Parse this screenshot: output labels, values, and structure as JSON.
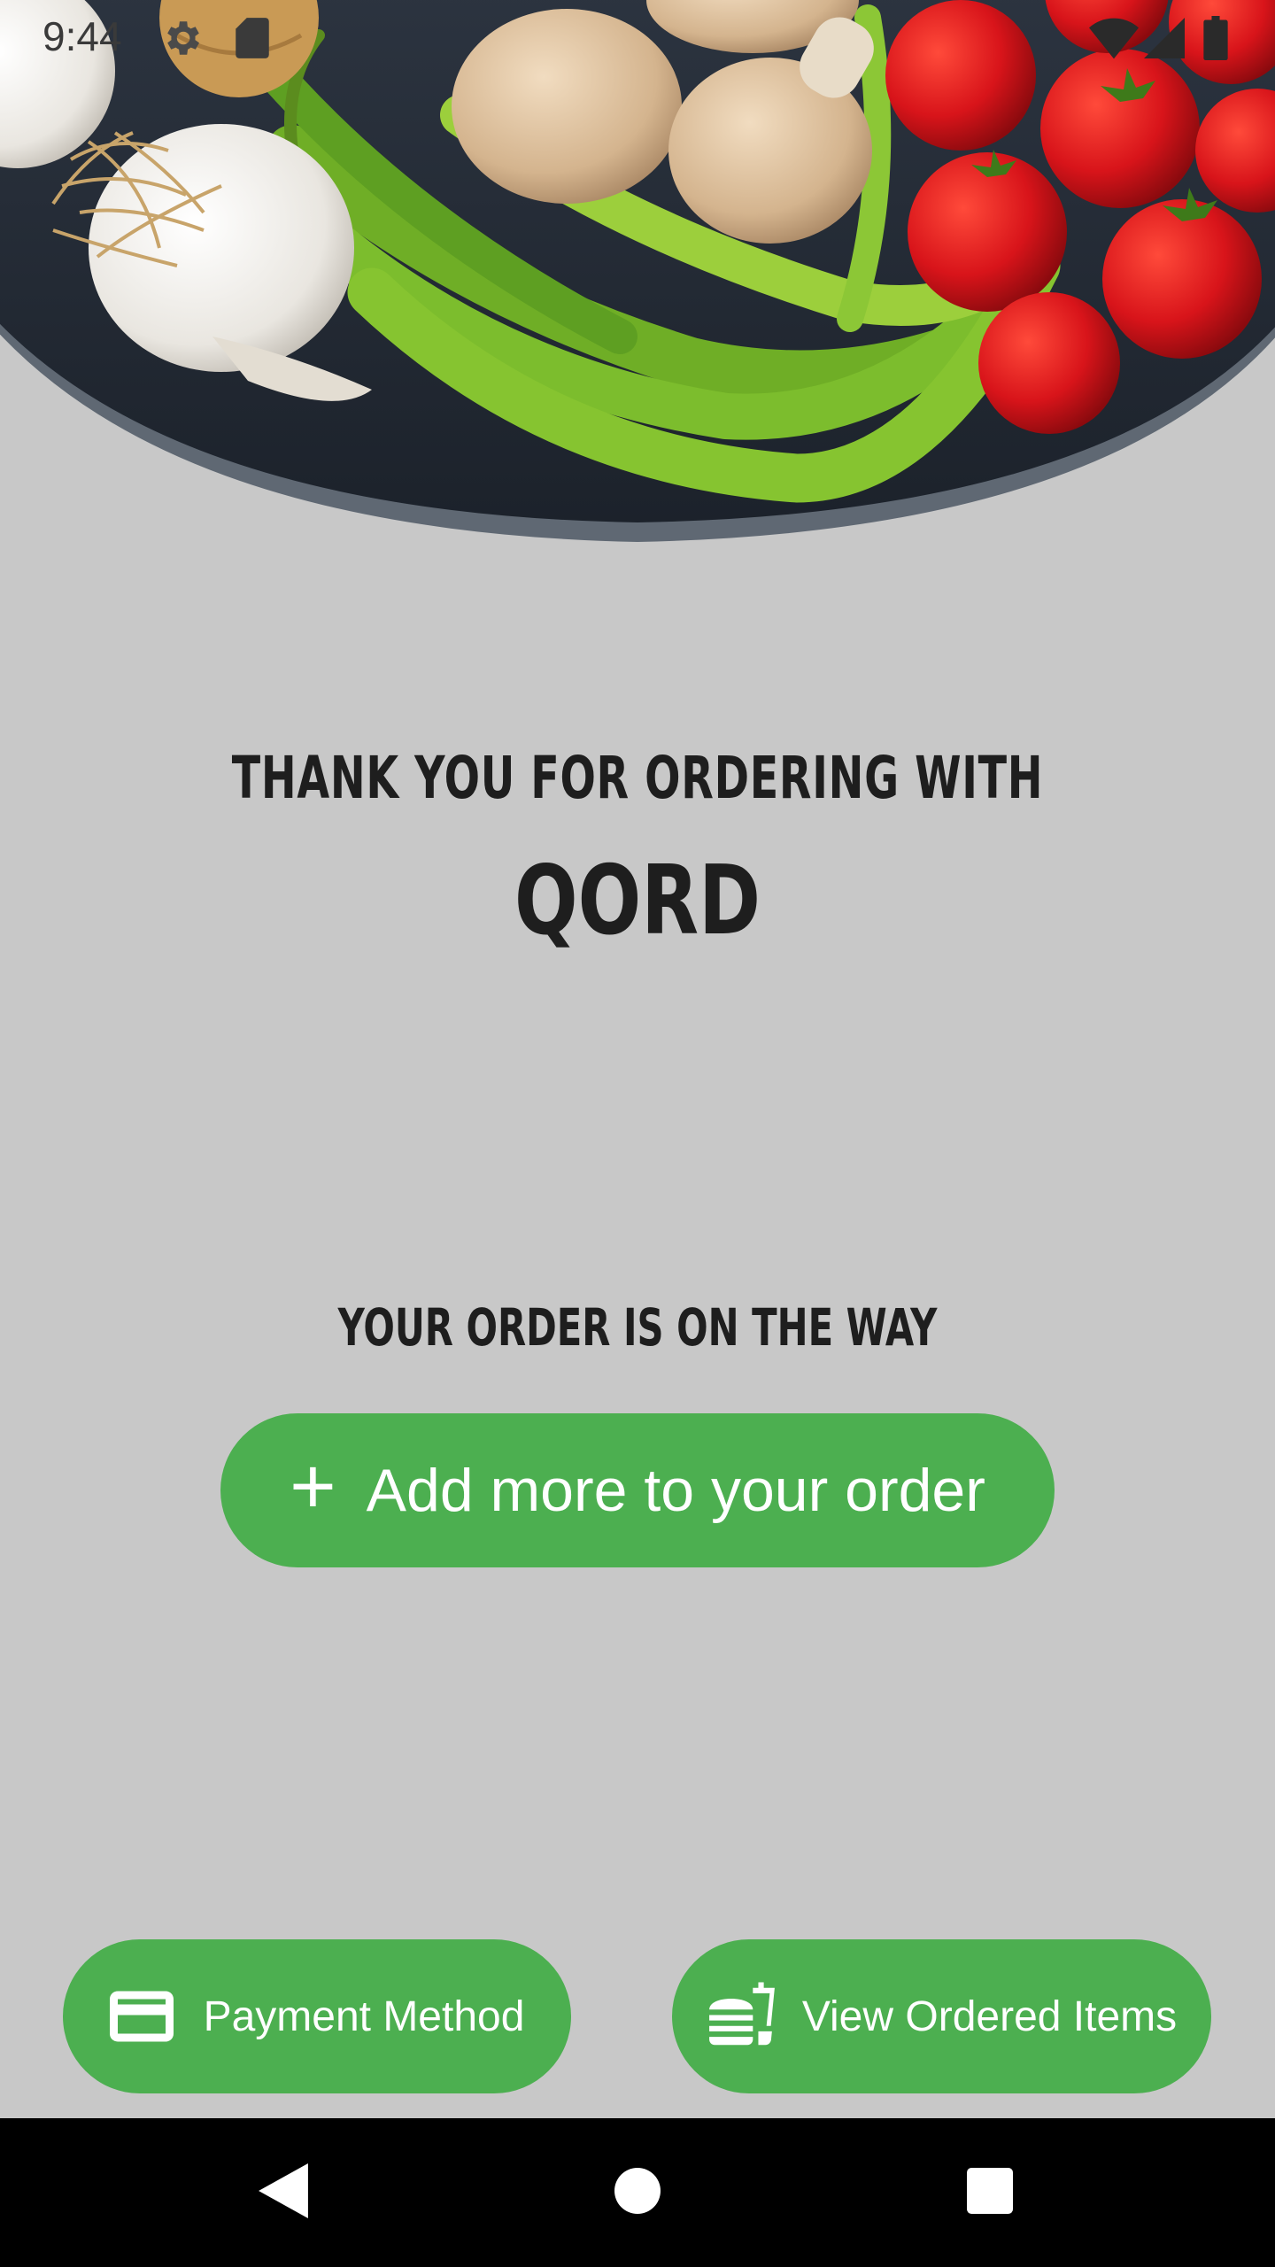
{
  "status_bar": {
    "time": "9:44",
    "icons": [
      "settings-gear-icon",
      "sd-card-icon",
      "wifi-icon",
      "cell-signal-icon",
      "battery-icon"
    ]
  },
  "hero": {
    "image": "vegetables-bowl-photo"
  },
  "headline": {
    "thank_you": "THANK YOU FOR ORDERING WITH",
    "brand": "QORD"
  },
  "status_message": "YOUR ORDER IS ON THE WAY",
  "actions": {
    "add_more": {
      "icon": "plus-icon",
      "label": "Add more to your order"
    },
    "payment": {
      "icon": "credit-card-icon",
      "label": "Payment Method"
    },
    "view_items": {
      "icon": "food-order-icon",
      "label": "View Ordered Items"
    }
  },
  "navigation": {
    "back": "back-triangle-icon",
    "home": "home-circle-icon",
    "recents": "recents-square-icon"
  },
  "colors": {
    "background": "#c8c8c8",
    "accent_green": "#4caf50",
    "text_dark": "#1e1e1e",
    "nav_bar": "#000000"
  }
}
